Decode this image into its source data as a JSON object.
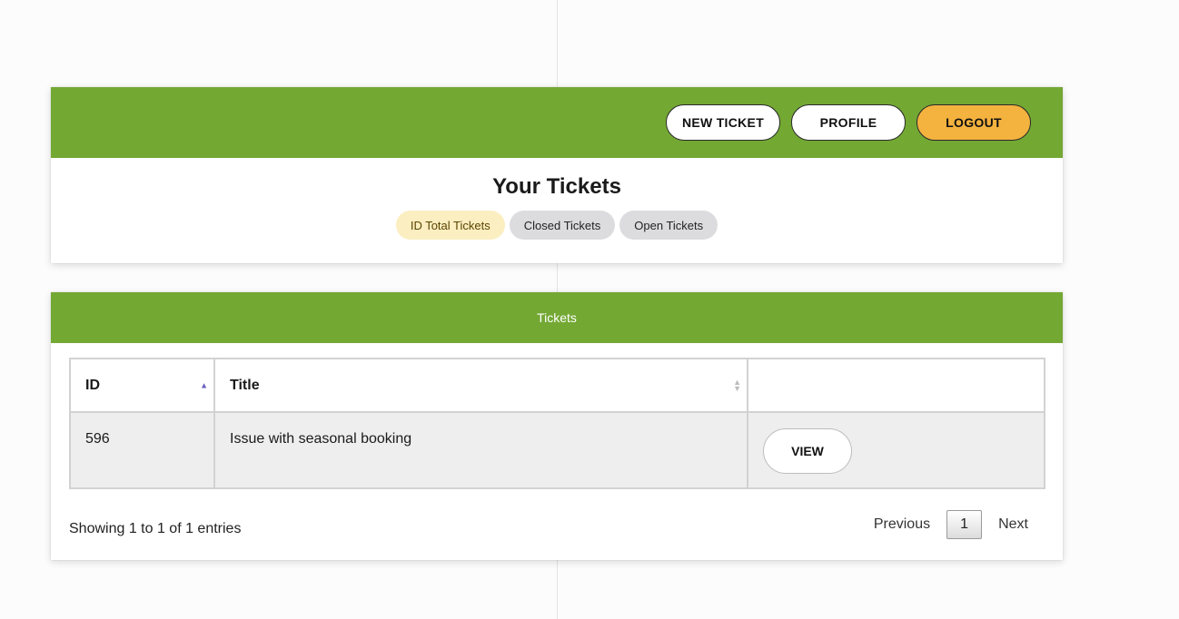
{
  "nav": {
    "new_ticket": "NEW TICKET",
    "profile": "PROFILE",
    "logout": "LOGOUT"
  },
  "page": {
    "title": "Your Tickets",
    "badges": [
      "ID Total Tickets",
      "Closed Tickets",
      "Open Tickets"
    ]
  },
  "tickets_panel": {
    "header": "Tickets",
    "columns": [
      "ID",
      "Title",
      ""
    ],
    "rows": [
      {
        "id": "596",
        "title": "Issue with seasonal booking",
        "action": "VIEW"
      }
    ],
    "info": "Showing 1 to 1 of 1 entries",
    "pagination": {
      "previous": "Previous",
      "current": "1",
      "next": "Next"
    }
  },
  "colors": {
    "header_green": "#73a833",
    "logout_orange": "#f4b23e",
    "badge_total": "#fbeec0",
    "badge_other": "#dcdcdf"
  }
}
